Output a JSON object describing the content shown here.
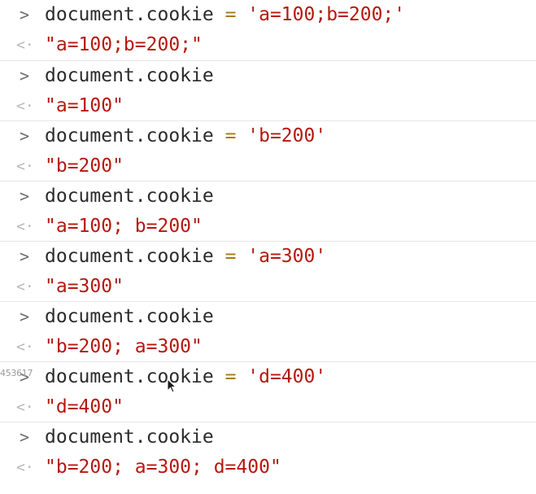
{
  "console": {
    "prompt_glyph": ">",
    "result_glyph": "<·",
    "side_label": "453617",
    "entries": [
      {
        "input": {
          "object": "document.cookie",
          "operator": " = ",
          "string": "'a=100;b=200;'"
        },
        "output": "\"a=100;b=200;\""
      },
      {
        "input": {
          "object": "document.cookie",
          "operator": "",
          "string": ""
        },
        "output": "\"a=100\""
      },
      {
        "input": {
          "object": "document.cookie",
          "operator": " = ",
          "string": "'b=200'"
        },
        "output": "\"b=200\""
      },
      {
        "input": {
          "object": "document.cookie",
          "operator": "",
          "string": ""
        },
        "output": "\"a=100; b=200\""
      },
      {
        "input": {
          "object": "document.cookie",
          "operator": " = ",
          "string": "'a=300'"
        },
        "output": "\"a=300\""
      },
      {
        "input": {
          "object": "document.cookie",
          "operator": "",
          "string": ""
        },
        "output": "\"b=200; a=300\""
      },
      {
        "input": {
          "object": "document.cookie",
          "operator": " = ",
          "string": "'d=400'"
        },
        "output": "\"d=400\""
      },
      {
        "input": {
          "object": "document.cookie",
          "operator": "",
          "string": ""
        },
        "output": "\"b=200; a=300; d=400\""
      }
    ]
  },
  "colors": {
    "code_text": "#2b2b2b",
    "operator": "#a87914",
    "string": "#b5180f",
    "prompt": "#6e6e6e",
    "result_arrow": "#b8b8b8",
    "divider": "#e6e6e6"
  },
  "icons": {
    "prompt": "chevron-right-icon",
    "result": "return-arrow-icon",
    "cursor": "mouse-pointer-icon"
  }
}
